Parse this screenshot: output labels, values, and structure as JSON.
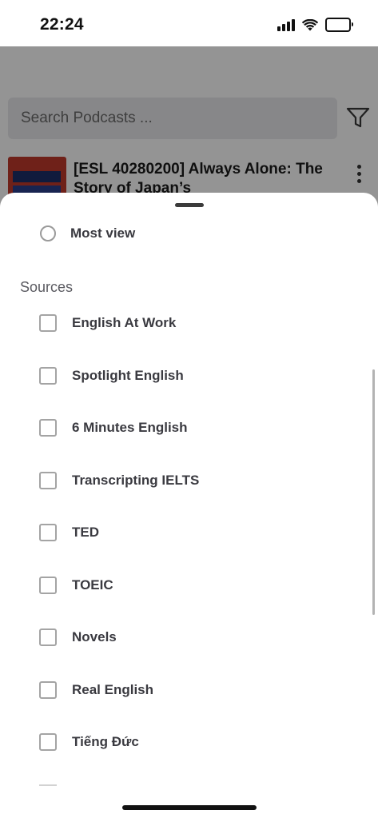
{
  "status_bar": {
    "time": "22:24",
    "icons": [
      "cellular-signal-icon",
      "wifi-icon",
      "battery-icon"
    ]
  },
  "background": {
    "search": {
      "placeholder": "Search Podcasts ..."
    },
    "podcast": {
      "title": "[ESL 40280200] Always Alone: The Story of Japan’s"
    },
    "icons": [
      "filter-icon",
      "more-vertical-icon"
    ]
  },
  "sheet": {
    "sort_option": {
      "label": "Most view",
      "selected": false
    },
    "sources_title": "Sources",
    "sources": [
      {
        "label": "English At Work",
        "checked": false
      },
      {
        "label": "Spotlight English",
        "checked": false
      },
      {
        "label": "6 Minutes English",
        "checked": false
      },
      {
        "label": "Transcripting IELTS",
        "checked": false
      },
      {
        "label": "TED",
        "checked": false
      },
      {
        "label": "TOEIC",
        "checked": false
      },
      {
        "label": "Novels",
        "checked": false
      },
      {
        "label": "Real English",
        "checked": false
      },
      {
        "label": "Tiếng Đức",
        "checked": false
      }
    ]
  },
  "colors": {
    "scrim": "#000000",
    "sheet_background": "#ffffff",
    "label_text": "#3a3a40"
  }
}
